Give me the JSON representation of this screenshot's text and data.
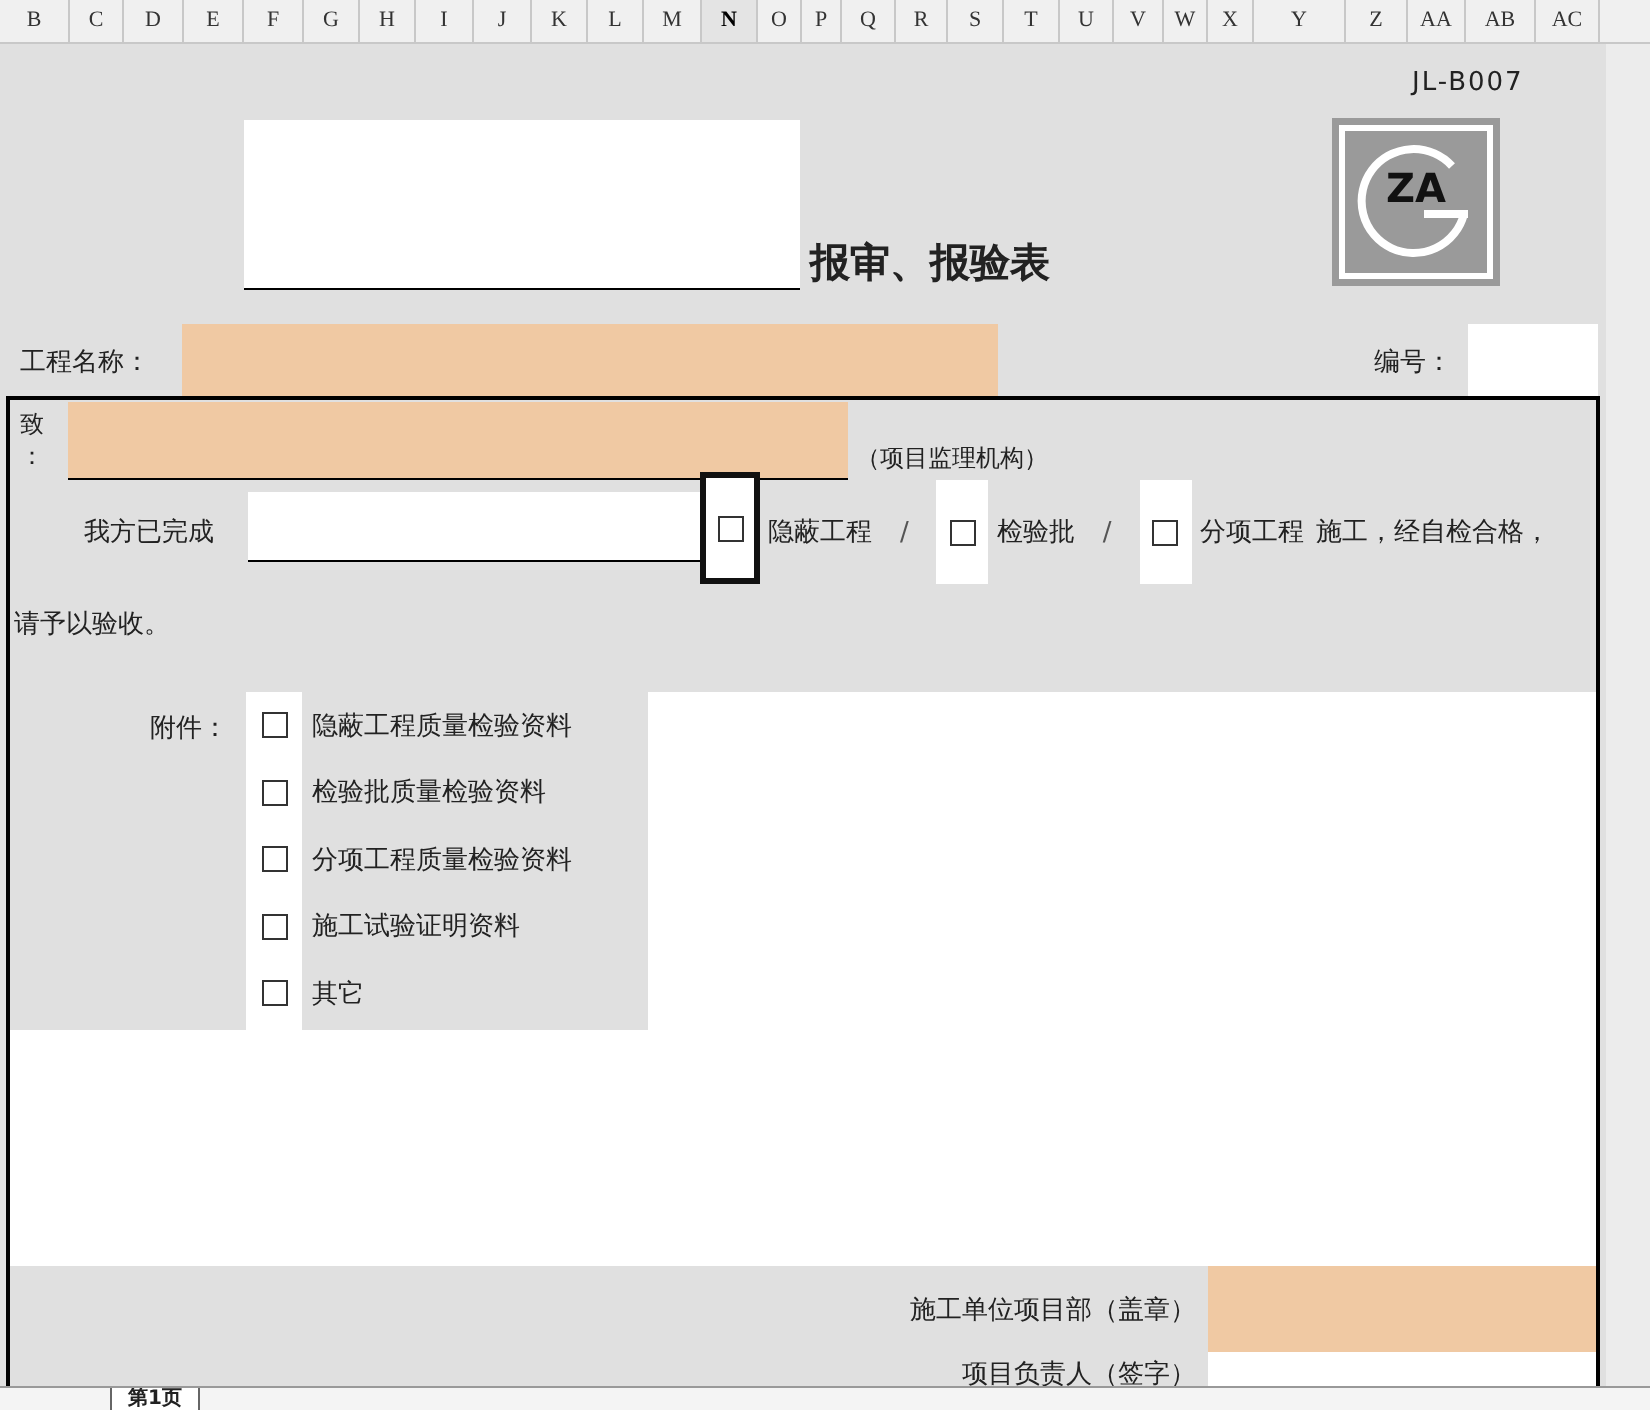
{
  "columns": [
    {
      "label": "B",
      "selected": false
    },
    {
      "label": "C",
      "selected": false
    },
    {
      "label": "D",
      "selected": false
    },
    {
      "label": "E",
      "selected": false
    },
    {
      "label": "F",
      "selected": false
    },
    {
      "label": "G",
      "selected": false
    },
    {
      "label": "H",
      "selected": false
    },
    {
      "label": "I",
      "selected": false
    },
    {
      "label": "J",
      "selected": false
    },
    {
      "label": "K",
      "selected": false
    },
    {
      "label": "L",
      "selected": false
    },
    {
      "label": "M",
      "selected": false
    },
    {
      "label": "N",
      "selected": true
    },
    {
      "label": "O",
      "selected": false
    },
    {
      "label": "P",
      "selected": false
    },
    {
      "label": "Q",
      "selected": false
    },
    {
      "label": "R",
      "selected": false
    },
    {
      "label": "S",
      "selected": false
    },
    {
      "label": "T",
      "selected": false
    },
    {
      "label": "U",
      "selected": false
    },
    {
      "label": "V",
      "selected": false
    },
    {
      "label": "W",
      "selected": false
    },
    {
      "label": "X",
      "selected": false
    },
    {
      "label": "Y",
      "selected": false
    },
    {
      "label": "Z",
      "selected": false
    },
    {
      "label": "AA",
      "selected": false
    },
    {
      "label": "AB",
      "selected": false
    },
    {
      "label": "AC",
      "selected": false
    }
  ],
  "form_code": "JL-B007",
  "logo_text": "ZA",
  "title": "报审、报验表",
  "project_label": "工程名称：",
  "number_label": "编号：",
  "to_label": "致：",
  "to_suffix": "（项目监理机构）",
  "completed_label": "我方已完成",
  "work_types": [
    {
      "label": "隐蔽工程",
      "checked": false,
      "selected": true
    },
    {
      "label": "检验批",
      "checked": false,
      "selected": false
    },
    {
      "label": "分项工程",
      "checked": false,
      "selected": false
    }
  ],
  "separator": "/",
  "sentence_tail": "施工，经自检合格，",
  "request_text": "请予以验收。",
  "attachments_label": "附件：",
  "attachments": [
    {
      "label": "隐蔽工程质量检验资料",
      "checked": false
    },
    {
      "label": "检验批质量检验资料",
      "checked": false
    },
    {
      "label": "分项工程质量检验资料",
      "checked": false
    },
    {
      "label": "施工试验证明资料",
      "checked": false
    },
    {
      "label": "其它",
      "checked": false
    }
  ],
  "signatures": [
    {
      "label": "施工单位项目部（盖章）",
      "kind": "filled"
    },
    {
      "label": "项目负责人（签字）",
      "kind": "blank"
    }
  ],
  "sheet_tabs": [
    {
      "label": "第1页",
      "selected": true
    }
  ]
}
